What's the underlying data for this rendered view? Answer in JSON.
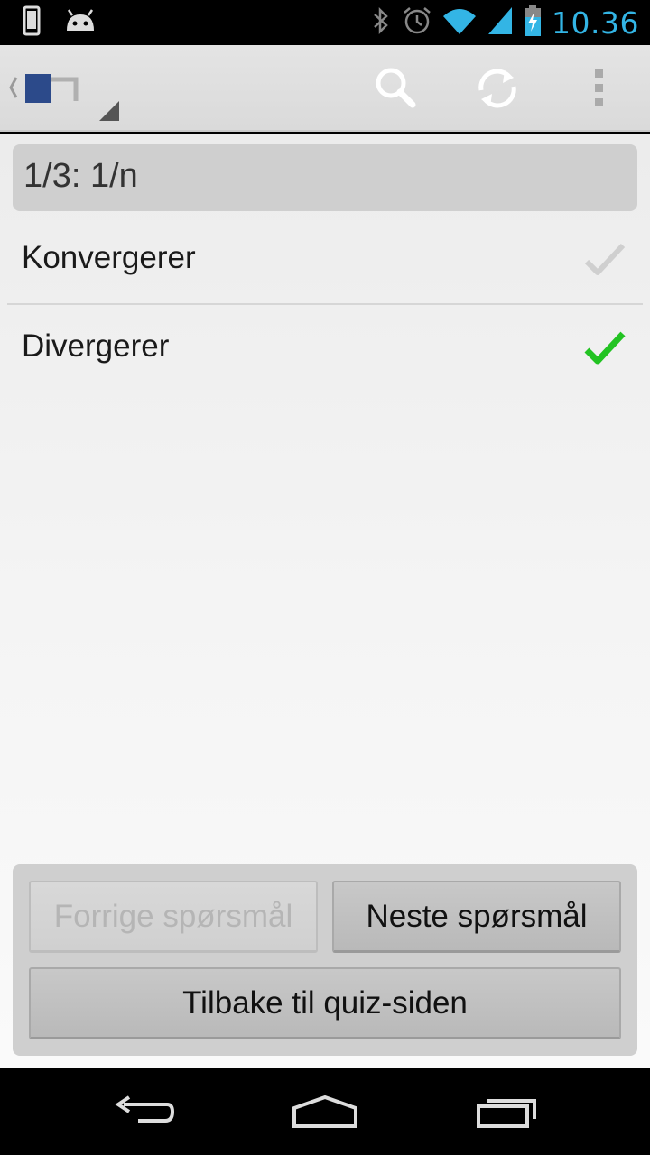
{
  "status_bar": {
    "time": "10.36",
    "icons": [
      "phone-vibrate-icon",
      "android-icon",
      "bluetooth-icon",
      "alarm-icon",
      "wifi-icon",
      "signal-icon",
      "battery-charging-icon"
    ],
    "accent_color": "#33b5e5"
  },
  "action_bar": {
    "home_icon": "app-logo-icon",
    "actions": [
      {
        "name": "search",
        "icon": "search-icon"
      },
      {
        "name": "refresh",
        "icon": "refresh-icon"
      },
      {
        "name": "overflow",
        "icon": "overflow-menu-icon"
      }
    ]
  },
  "question": {
    "header": "1/3: 1/n"
  },
  "answers": [
    {
      "label": "Konvergerer",
      "checked": false,
      "icon": "check-icon-inactive"
    },
    {
      "label": "Divergerer",
      "checked": true,
      "icon": "check-icon-correct",
      "check_color": "#22c322"
    }
  ],
  "buttons": {
    "previous": {
      "label": "Forrige spørsmål",
      "enabled": false
    },
    "next": {
      "label": "Neste spørsmål",
      "enabled": true
    },
    "back": {
      "label": "Tilbake til quiz-siden",
      "enabled": true
    }
  },
  "nav_bar": {
    "buttons": [
      "back-icon",
      "home-icon",
      "recent-apps-icon"
    ]
  }
}
